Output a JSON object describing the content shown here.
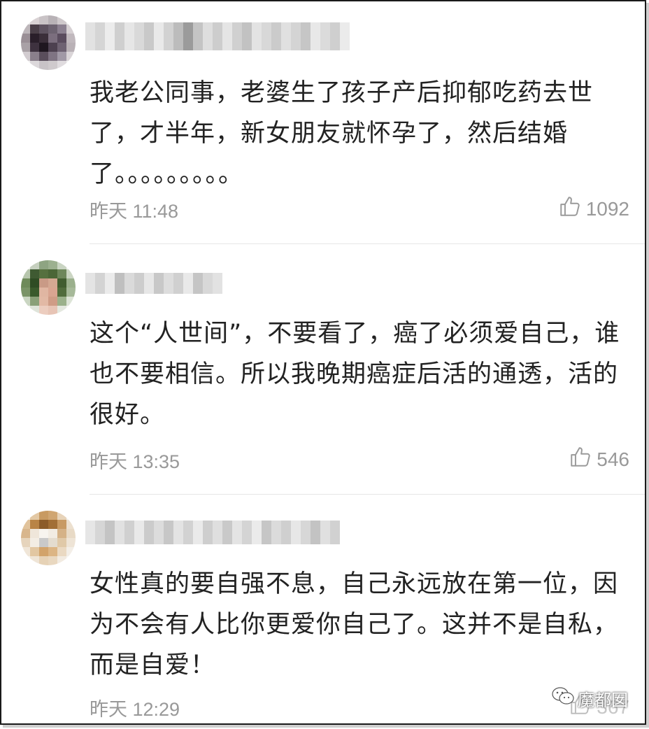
{
  "comments": [
    {
      "text": "我老公同事，老婆生了孩子产后抑郁吃药去世了，才半年，新女朋友就怀孕了，然后结婚了。。。。。。。。。",
      "time": "昨天 11:48",
      "likes": "1092"
    },
    {
      "text": "这个“人世间”，不要看了，癌了必须爱自己，谁也不要相信。所以我晚期癌症后活的通透，活的很好。",
      "time": "昨天 13:35",
      "likes": "546"
    },
    {
      "text": "女性真的要自强不息，自己永远放在第一位，因为不会有人比你更爱你自己了。这并不是自私，而是自爱！",
      "time": "昨天 12:29",
      "likes": "367"
    }
  ],
  "icons": {
    "like": "thumbs-up-outline-icon",
    "watermark": "wechat-icon"
  },
  "watermark": {
    "label": "魔都囡"
  },
  "colors": {
    "text": "#222222",
    "meta": "#999999",
    "divider": "#e6e6e6"
  }
}
